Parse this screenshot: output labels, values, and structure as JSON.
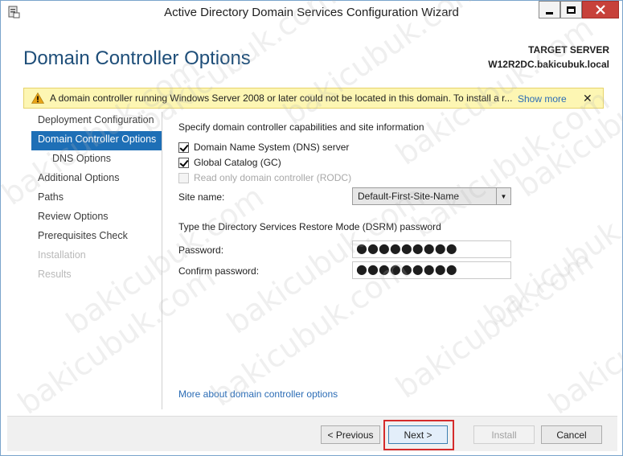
{
  "window": {
    "title": "Active Directory Domain Services Configuration Wizard"
  },
  "header": {
    "page_title": "Domain Controller Options",
    "target_server_label": "TARGET SERVER",
    "target_server_name": "W12R2DC.bakicubuk.local"
  },
  "warning": {
    "text": "A domain controller running Windows Server 2008 or later could not be located in this domain. To install a r...",
    "show_more": "Show more",
    "close_glyph": "✕"
  },
  "nav": {
    "items": [
      {
        "label": "Deployment Configuration",
        "state": "normal"
      },
      {
        "label": "Domain Controller Options",
        "state": "active"
      },
      {
        "label": "DNS Options",
        "state": "sub"
      },
      {
        "label": "Additional Options",
        "state": "normal"
      },
      {
        "label": "Paths",
        "state": "normal"
      },
      {
        "label": "Review Options",
        "state": "normal"
      },
      {
        "label": "Prerequisites Check",
        "state": "normal"
      },
      {
        "label": "Installation",
        "state": "disabled"
      },
      {
        "label": "Results",
        "state": "disabled"
      }
    ]
  },
  "content": {
    "capabilities_heading": "Specify domain controller capabilities and site information",
    "checkboxes": [
      {
        "label": "Domain Name System (DNS) server",
        "checked": true,
        "enabled": true
      },
      {
        "label": "Global Catalog (GC)",
        "checked": true,
        "enabled": true
      },
      {
        "label": "Read only domain controller (RODC)",
        "checked": false,
        "enabled": false
      }
    ],
    "site_name_label": "Site name:",
    "site_name_value": "Default-First-Site-Name",
    "dsrm_heading": "Type the Directory Services Restore Mode (DSRM) password",
    "password_label": "Password:",
    "password_mask": "●●●●●●●●●",
    "confirm_password_label": "Confirm password:",
    "confirm_password_mask": "●●●●●●●●●",
    "more_link": "More about domain controller options"
  },
  "footer": {
    "previous": "< Previous",
    "next": "Next >",
    "install": "Install",
    "cancel": "Cancel"
  },
  "watermark_text": "bakicubuk.com",
  "colors": {
    "accent": "#1e6fb6",
    "title_blue": "#1e4e79",
    "warning_bg": "#fdf6b3",
    "highlight_red": "#d52b2b",
    "close_red": "#c7413a"
  }
}
